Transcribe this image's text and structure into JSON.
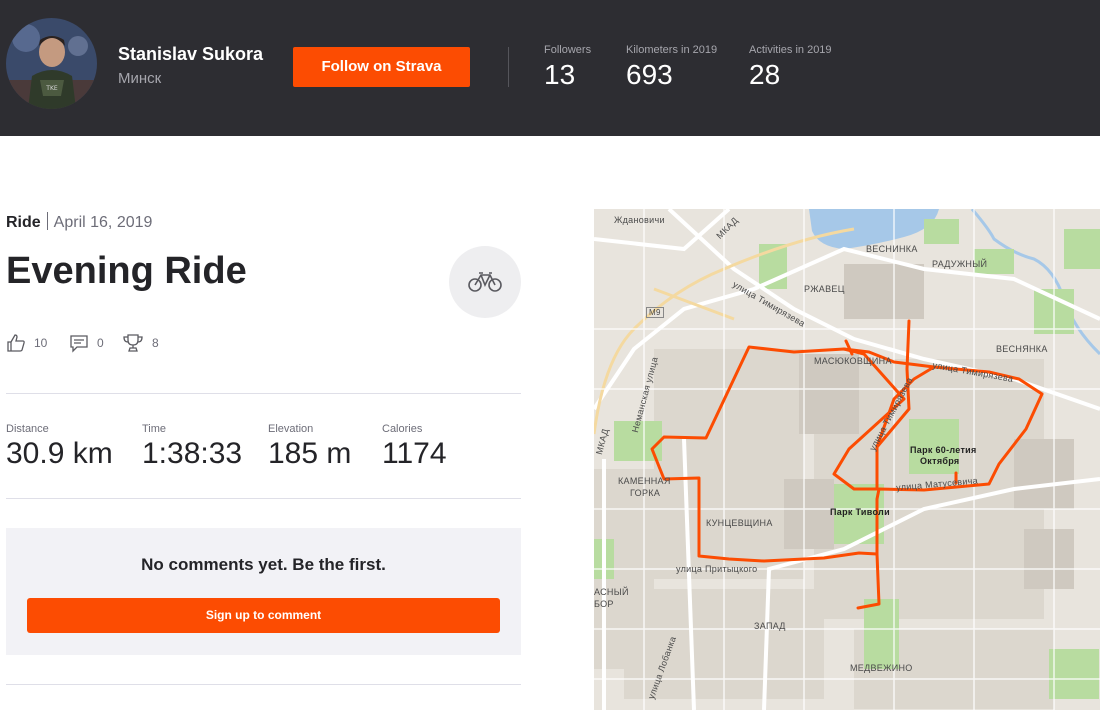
{
  "header": {
    "athlete_name": "Stanislav Sukora",
    "location": "Минск",
    "follow_label": "Follow on Strava",
    "stats": [
      {
        "label": "Followers",
        "value": "13"
      },
      {
        "label": "Kilometers in 2019",
        "value": "693"
      },
      {
        "label": "Activities in 2019",
        "value": "28"
      }
    ]
  },
  "activity": {
    "type": "Ride",
    "date": "April 16, 2019",
    "title": "Evening Ride",
    "icon": "bike-icon",
    "kudos": "10",
    "comments": "0",
    "achievements": "8",
    "metrics": [
      {
        "label": "Distance",
        "value": "30.9 km"
      },
      {
        "label": "Time",
        "value": "1:38:33"
      },
      {
        "label": "Elevation",
        "value": "185 m"
      },
      {
        "label": "Calories",
        "value": "1174"
      }
    ]
  },
  "comments_box": {
    "empty_text": "No comments yet. Be the first.",
    "signup_label": "Sign up to comment"
  },
  "map": {
    "route_color": "#fc4c02",
    "labels": {
      "zhdanovichi": "Ждановичи",
      "mkad_top": "МКАД",
      "vesninka": "ВЕСНИНКА",
      "raduzhny": "РАДУЖНЫЙ",
      "rzhavets": "РЖАВЕЦ",
      "timiryazeva_upper": "улица Тимирязева",
      "m9": "М9",
      "masyukovshchina": "МАСЮКОВЩИНА",
      "timiryazeva": "улица Тимирязева",
      "vesnyanka": "ВЕСНЯНКА",
      "nemanskaya": "Неманская улица",
      "mkad_left": "МКАД",
      "tikhaya": "улица Тимирязева",
      "park60_line1": "Парк 60-летия",
      "park60_line2": "Октября",
      "matusevicha": "улица Матусевича",
      "kamennaya_line1": "КАМЕННАЯ",
      "kamennaya_line2": "ГОРКА",
      "kuntsevshchina": "КУНЦЕВЩИНА",
      "park_tivoli": "Парк Тиволи",
      "pritytskogo": "улица Притыцкого",
      "zapad": "ЗАПАД",
      "medvezhino": "МЕДВЕЖИНО",
      "lobanka": "улица Лобанка",
      "krasny_line1": "АСНЫЙ",
      "krasny_line2": "БОР"
    }
  }
}
